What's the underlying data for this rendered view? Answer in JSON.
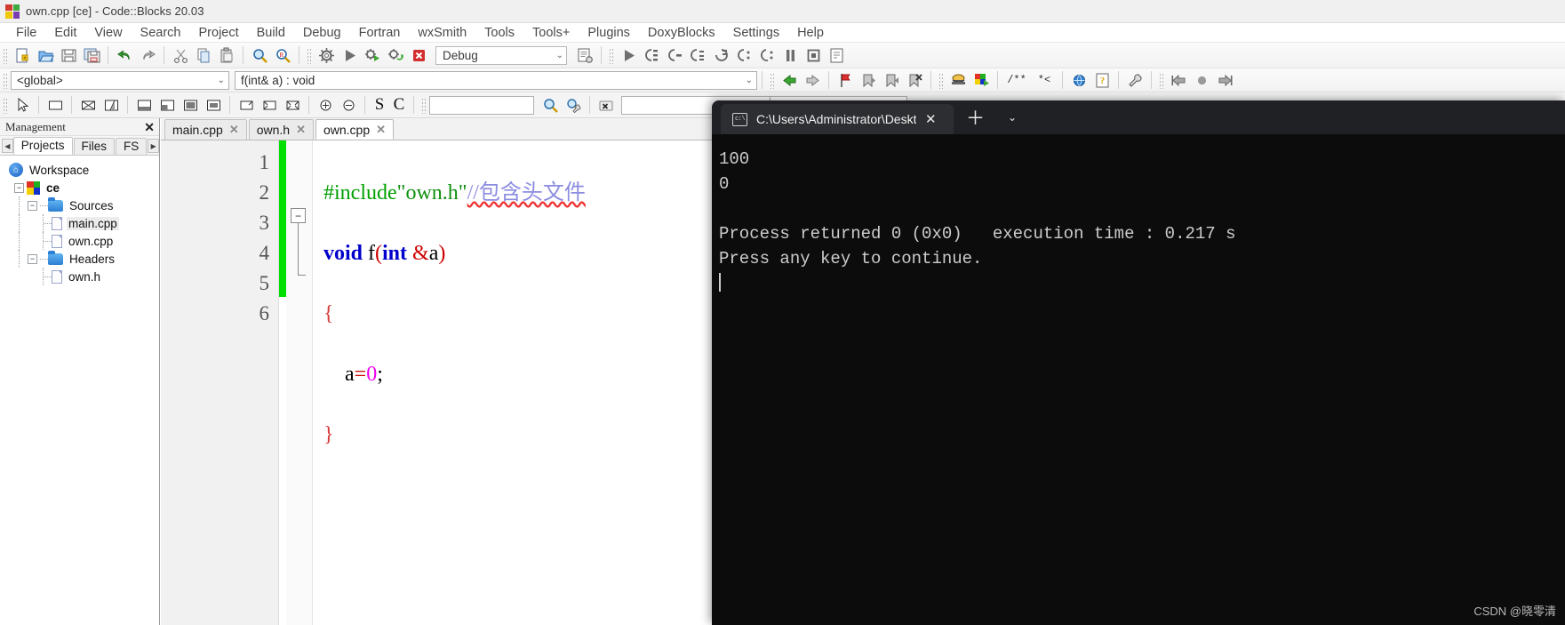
{
  "window": {
    "title": "own.cpp [ce] - Code::Blocks 20.03",
    "logo_icon": "codeblocks-logo-icon"
  },
  "menubar": {
    "items": [
      {
        "label": "File"
      },
      {
        "label": "Edit"
      },
      {
        "label": "View"
      },
      {
        "label": "Search"
      },
      {
        "label": "Project"
      },
      {
        "label": "Build"
      },
      {
        "label": "Debug"
      },
      {
        "label": "Fortran"
      },
      {
        "label": "wxSmith"
      },
      {
        "label": "Tools"
      },
      {
        "label": "Tools+"
      },
      {
        "label": "Plugins"
      },
      {
        "label": "DoxyBlocks"
      },
      {
        "label": "Settings"
      },
      {
        "label": "Help"
      }
    ]
  },
  "toolbar_main": {
    "target_combo": {
      "value": "Debug",
      "chevron": "chevron-down-icon"
    },
    "buttons": [
      {
        "name": "new-file-button",
        "glyph": "new-file-icon"
      },
      {
        "name": "open-file-button",
        "glyph": "open-folder-icon"
      },
      {
        "name": "save-button",
        "glyph": "floppy-disk-icon"
      },
      {
        "name": "save-all-button",
        "glyph": "save-all-icon"
      },
      {
        "name": "undo-button",
        "glyph": "undo-arrow-icon"
      },
      {
        "name": "redo-button",
        "glyph": "redo-arrow-icon"
      },
      {
        "name": "cut-button",
        "glyph": "scissors-icon"
      },
      {
        "name": "copy-button",
        "glyph": "copy-icon"
      },
      {
        "name": "paste-button",
        "glyph": "clipboard-icon"
      },
      {
        "name": "find-button",
        "glyph": "magnifier-icon"
      },
      {
        "name": "replace-button",
        "glyph": "magnifier-replace-icon"
      },
      {
        "name": "build-button",
        "glyph": "gear-icon"
      },
      {
        "name": "run-button",
        "glyph": "play-triangle-icon"
      },
      {
        "name": "build-and-run-button",
        "glyph": "gear-play-icon"
      },
      {
        "name": "rebuild-button",
        "glyph": "rebuild-arrows-icon"
      },
      {
        "name": "abort-build-button",
        "glyph": "red-x-icon"
      },
      {
        "name": "build-target-options-button",
        "glyph": "list-gear-icon"
      },
      {
        "name": "debug-continue-button",
        "glyph": "play-triangle-icon"
      },
      {
        "name": "debug-run-to-cursor-button",
        "glyph": "step-lines-icon"
      },
      {
        "name": "debug-next-line-button",
        "glyph": "step-over-icon"
      },
      {
        "name": "debug-step-into-button",
        "glyph": "step-into-icon"
      },
      {
        "name": "debug-step-out-button",
        "glyph": "step-out-icon"
      },
      {
        "name": "debug-next-instruction-button",
        "glyph": "next-instruction-icon"
      },
      {
        "name": "debug-step-instruction-button",
        "glyph": "step-instruction-icon"
      },
      {
        "name": "debug-break-button",
        "glyph": "pause-icon"
      },
      {
        "name": "debug-stop-button",
        "glyph": "stop-square-icon"
      },
      {
        "name": "debug-info-button",
        "glyph": "debug-info-icon"
      }
    ]
  },
  "toolbar_scope": {
    "scope_combo": {
      "value": "<global>",
      "chevron": "chevron-down-icon"
    },
    "function_combo": {
      "value": "f(int& a) : void",
      "chevron": "chevron-down-icon"
    },
    "buttons": [
      {
        "name": "nav-back-button",
        "glyph": "left-arrow-icon"
      },
      {
        "name": "nav-forward-button",
        "glyph": "right-arrow-icon"
      },
      {
        "name": "toggle-bookmark-button",
        "glyph": "red-flag-icon"
      },
      {
        "name": "previous-bookmark-button",
        "glyph": "prev-bookmark-icon"
      },
      {
        "name": "next-bookmark-button",
        "glyph": "next-bookmark-icon"
      },
      {
        "name": "clear-bookmarks-button",
        "glyph": "clear-bookmark-icon"
      },
      {
        "name": "doxyblocks-extract-button",
        "glyph": "doxygen-icon"
      },
      {
        "name": "doxyblocks-run-button",
        "glyph": "doxygen-run-icon"
      },
      {
        "name": "doxyblocks-comment-button",
        "glyph": "comment-block-icon"
      },
      {
        "name": "doxyblocks-uncomment-button",
        "glyph": "uncomment-icon"
      },
      {
        "name": "doxyblocks-open-html-button",
        "glyph": "globe-icon"
      },
      {
        "name": "doxyblocks-help-button",
        "glyph": "question-help-icon"
      },
      {
        "name": "doxyblocks-config-button",
        "glyph": "wrench-icon"
      },
      {
        "name": "jump-start-button",
        "glyph": "jump-left-icon"
      },
      {
        "name": "record-button",
        "glyph": "circle-dot-icon"
      },
      {
        "name": "jump-end-button",
        "glyph": "jump-right-icon"
      }
    ]
  },
  "toolbar_wxsmith": {
    "buttons": [
      {
        "name": "pointer-tool-button",
        "glyph": "cursor-arrow-icon"
      },
      {
        "name": "panel-tool-button",
        "glyph": "rectangle-icon"
      },
      {
        "name": "box-sizer-button",
        "glyph": "box-sizer-icon"
      },
      {
        "name": "grid-sizer-button",
        "glyph": "grid-sizer-icon"
      },
      {
        "name": "layout-top-button",
        "glyph": "layout-top-icon"
      },
      {
        "name": "layout-left-button",
        "glyph": "layout-left-icon"
      },
      {
        "name": "layout-bottom-button",
        "glyph": "layout-bottom-icon"
      },
      {
        "name": "layout-fill-button",
        "glyph": "layout-fill-icon"
      },
      {
        "name": "expand-button",
        "glyph": "expand-corner-icon"
      },
      {
        "name": "shrink-button",
        "glyph": "shrink-corner-icon"
      },
      {
        "name": "stretch-button",
        "glyph": "stretch-icon"
      },
      {
        "name": "zoom-in-button",
        "glyph": "zoom-in-icon"
      },
      {
        "name": "zoom-out-button",
        "glyph": "zoom-out-icon"
      },
      {
        "name": "select-s-button",
        "glyph": "letter-s-icon"
      },
      {
        "name": "select-c-button",
        "glyph": "letter-c-icon"
      },
      {
        "name": "search-symbol-button",
        "glyph": "magnifier-icon"
      },
      {
        "name": "search-options-button",
        "glyph": "magnifier-wrench-icon"
      },
      {
        "name": "clear-search-button",
        "glyph": "clear-x-icon"
      }
    ],
    "search_input": {
      "value": "",
      "placeholder": ""
    },
    "symbol_input": {
      "value": "",
      "placeholder": ""
    }
  },
  "management_panel": {
    "title": "Management",
    "close_icon": "close-x-icon",
    "tabs": [
      {
        "label": "Projects",
        "active": true
      },
      {
        "label": "Files",
        "active": false
      },
      {
        "label": "FS",
        "active": false
      }
    ],
    "scroll_left_icon": "scroll-left-icon",
    "scroll_right_icon": "scroll-right-icon",
    "tree": [
      {
        "label": "Workspace",
        "icon": "home-icon",
        "depth": 0,
        "expander": null,
        "selected": false,
        "bold": false
      },
      {
        "label": "ce",
        "icon": "project-icon",
        "depth": 1,
        "expander": "minus",
        "selected": false,
        "bold": true
      },
      {
        "label": "Sources",
        "icon": "folder-icon",
        "depth": 2,
        "expander": "minus",
        "selected": false,
        "bold": false
      },
      {
        "label": "main.cpp",
        "icon": "file-icon",
        "depth": 3,
        "expander": null,
        "selected": true,
        "bold": false
      },
      {
        "label": "own.cpp",
        "icon": "file-icon",
        "depth": 3,
        "expander": null,
        "selected": false,
        "bold": false
      },
      {
        "label": "Headers",
        "icon": "folder-icon",
        "depth": 2,
        "expander": "minus",
        "selected": false,
        "bold": false
      },
      {
        "label": "own.h",
        "icon": "file-icon",
        "depth": 3,
        "expander": null,
        "selected": false,
        "bold": false
      }
    ]
  },
  "editor": {
    "tabs": [
      {
        "label": "main.cpp",
        "close_icon": "close-x-icon",
        "active": false
      },
      {
        "label": "own.h",
        "close_icon": "close-x-icon",
        "active": false
      },
      {
        "label": "own.cpp",
        "close_icon": "close-x-icon",
        "active": true
      }
    ],
    "line_numbers": [
      "1",
      "2",
      "3",
      "4",
      "5",
      "6"
    ],
    "code_lines": [
      {
        "n": 1,
        "text": "#include\"own.h\"//包含头文件"
      },
      {
        "n": 2,
        "text": "void f(int &a)"
      },
      {
        "n": 3,
        "text": "{"
      },
      {
        "n": 4,
        "text": "    a=0;"
      },
      {
        "n": 5,
        "text": "}"
      },
      {
        "n": 6,
        "text": ""
      }
    ],
    "tokens": {
      "l1_include": "#include",
      "l1_string": "\"own.h\"",
      "l1_comment": "//包含头文件",
      "l2_void": "void",
      "l2_fname": " f",
      "l2_paren_open": "(",
      "l2_int": "int",
      "l2_amp": " &",
      "l2_a": "a",
      "l2_paren_close": ")",
      "l3_brace": "{",
      "l4_a": "a",
      "l4_eq": "=",
      "l4_zero": "0",
      "l4_semi": ";",
      "l5_brace": "}"
    },
    "fold_icon": "fold-collapse-icon"
  },
  "console": {
    "tab_title": "C:\\Users\\Administrator\\Deskto",
    "terminal_icon": "terminal-cmd-icon",
    "close_icon": "close-x-icon",
    "new_tab_icon": "plus-icon",
    "dropdown_icon": "chevron-down-icon",
    "output_lines": [
      "100",
      "0",
      "",
      "Process returned 0 (0x0)   execution time : 0.217 s",
      "Press any key to continue."
    ]
  },
  "watermark": {
    "text": "CSDN @晓零清"
  }
}
